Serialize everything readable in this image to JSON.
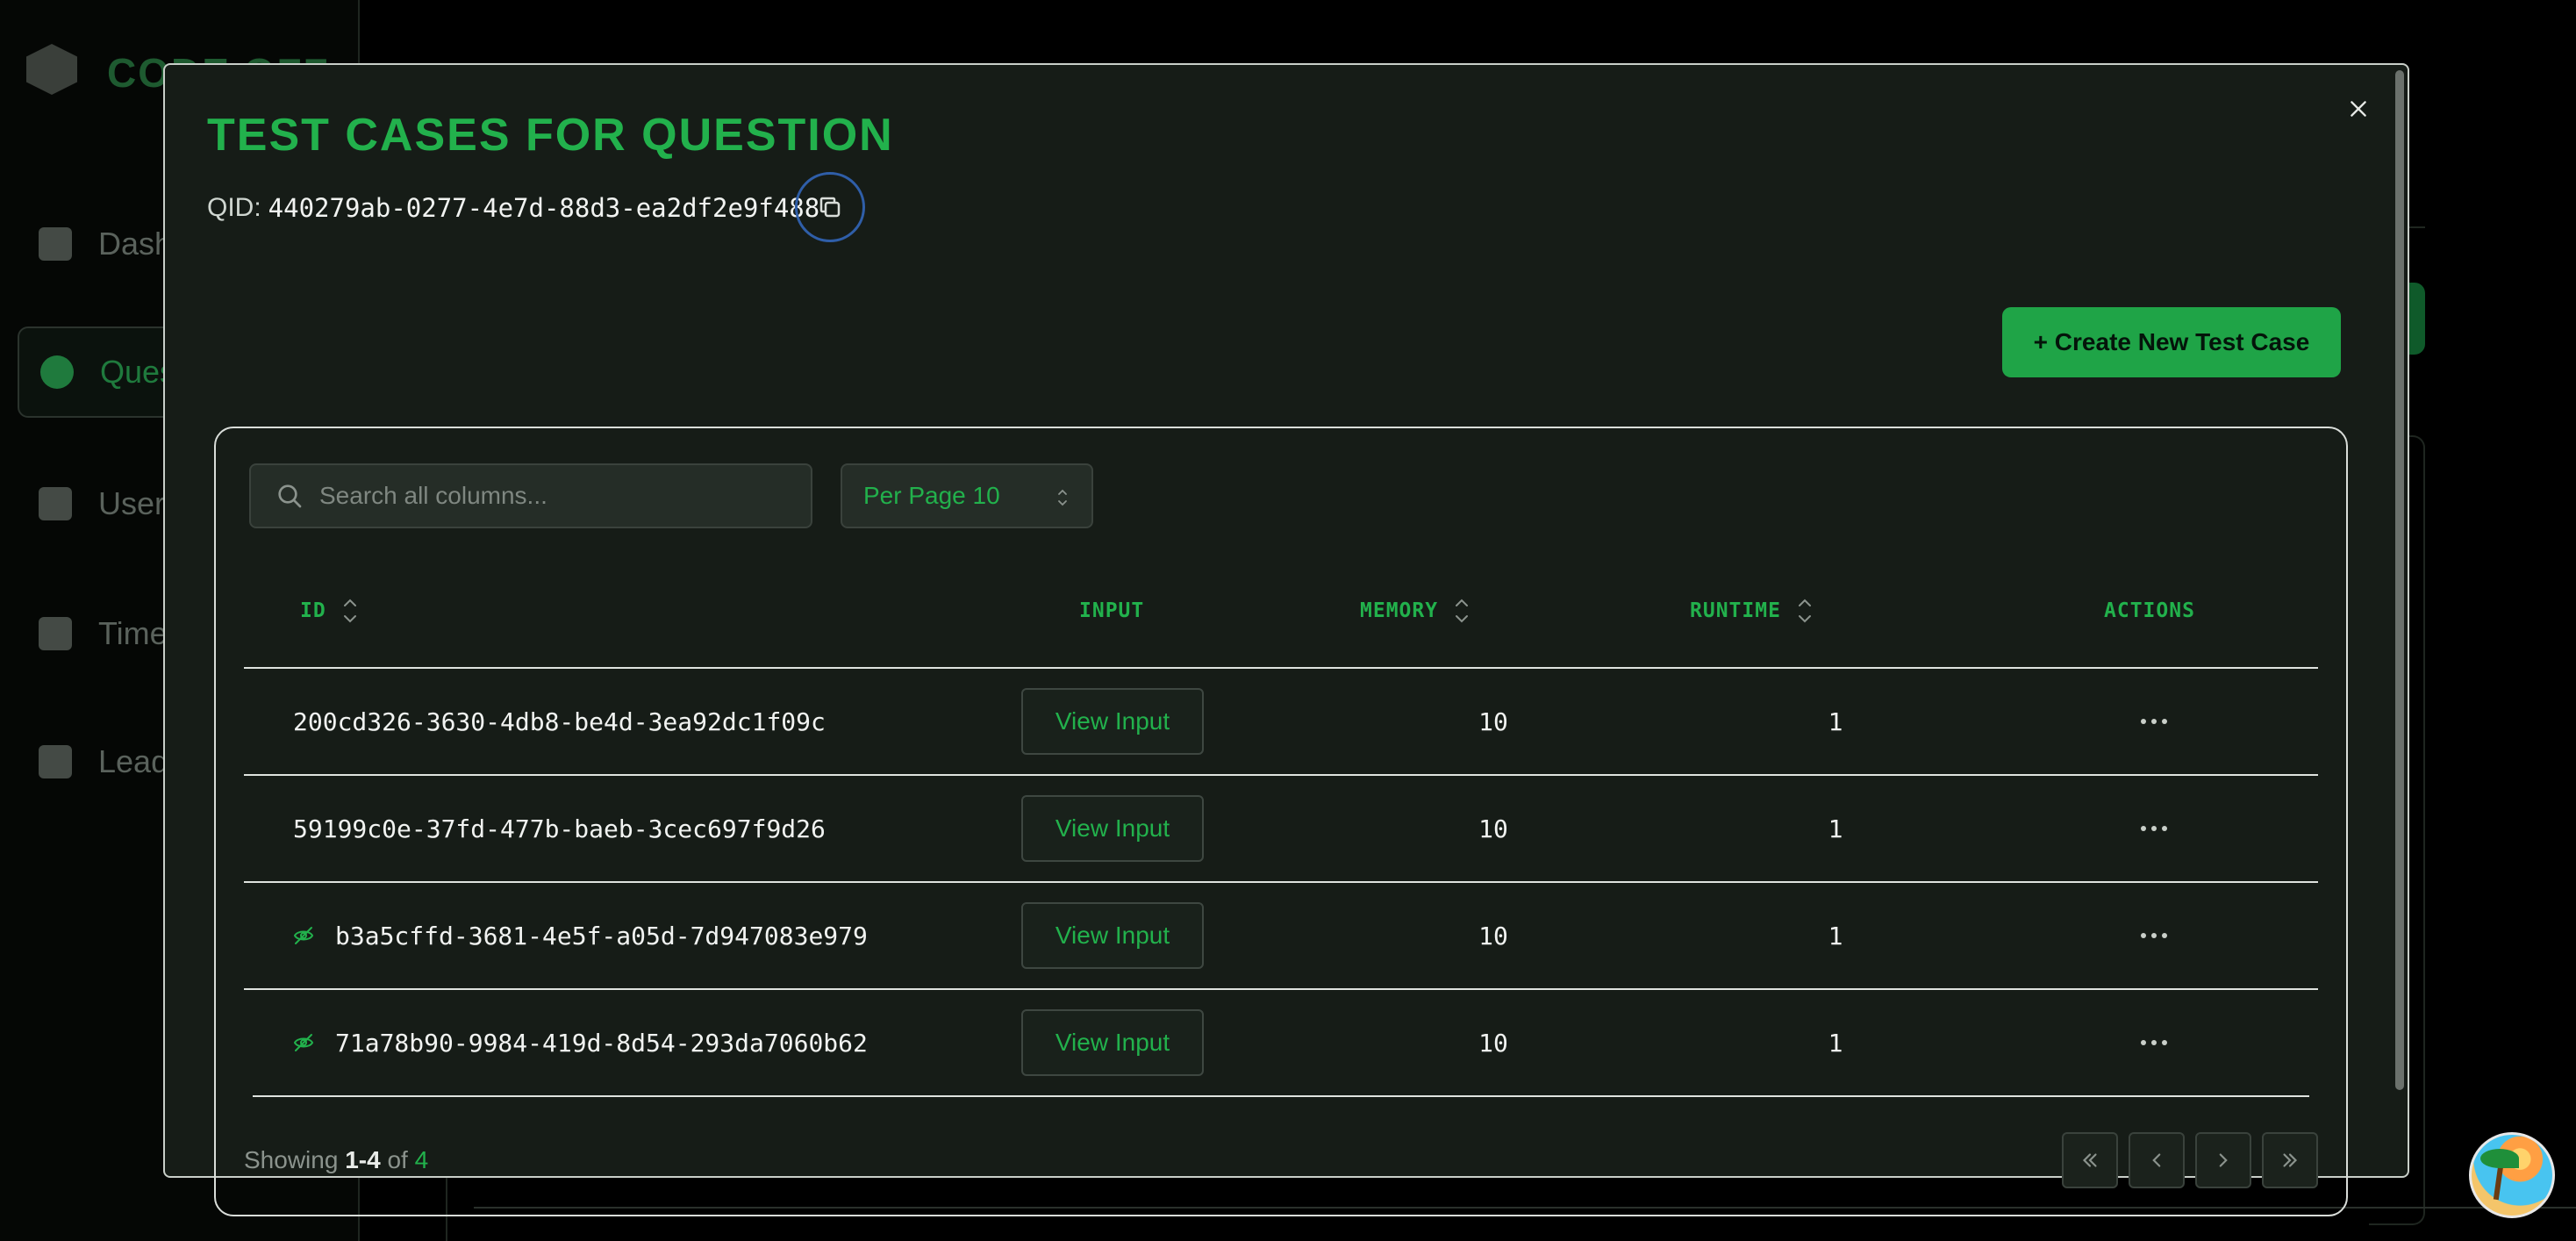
{
  "background": {
    "brand": "CODE OFF",
    "nav": [
      "Dash",
      "Ques",
      "User",
      "Time",
      "Lead"
    ]
  },
  "modal": {
    "title": "TEST CASES FOR QUESTION",
    "qid_label": "QID:",
    "qid_value": "440279ab-0277-4e7d-88d3-ea2df2e9f488",
    "create_button": "+ Create New Test Case",
    "search_placeholder": "Search all columns...",
    "per_page": "Per Page 10",
    "columns": [
      "ID",
      "INPUT",
      "MEMORY",
      "RUNTIME",
      "ACTIONS"
    ],
    "rows": [
      {
        "id": "200cd326-3630-4db8-be4d-3ea92dc1f09c",
        "hidden": false,
        "input_label": "View Input",
        "memory": "10",
        "runtime": "1"
      },
      {
        "id": "59199c0e-37fd-477b-baeb-3cec697f9d26",
        "hidden": false,
        "input_label": "View Input",
        "memory": "10",
        "runtime": "1"
      },
      {
        "id": "b3a5cffd-3681-4e5f-a05d-7d947083e979",
        "hidden": true,
        "input_label": "View Input",
        "memory": "10",
        "runtime": "1"
      },
      {
        "id": "71a78b90-9984-419d-8d54-293da7060b62",
        "hidden": true,
        "input_label": "View Input",
        "memory": "10",
        "runtime": "1"
      }
    ],
    "footer": {
      "showing_prefix": "Showing",
      "range": "1-4",
      "of": "of",
      "total": "4"
    }
  },
  "colors": {
    "accent": "#22b14c",
    "button": "#1fa447",
    "modal_bg": "#161c17"
  },
  "icons": [
    "close-icon",
    "copy-icon",
    "search-icon",
    "chevron-updown-icon",
    "sort-icon",
    "eye-off-icon",
    "more-horizontal-icon",
    "first-page-icon",
    "prev-page-icon",
    "next-page-icon",
    "last-page-icon"
  ]
}
